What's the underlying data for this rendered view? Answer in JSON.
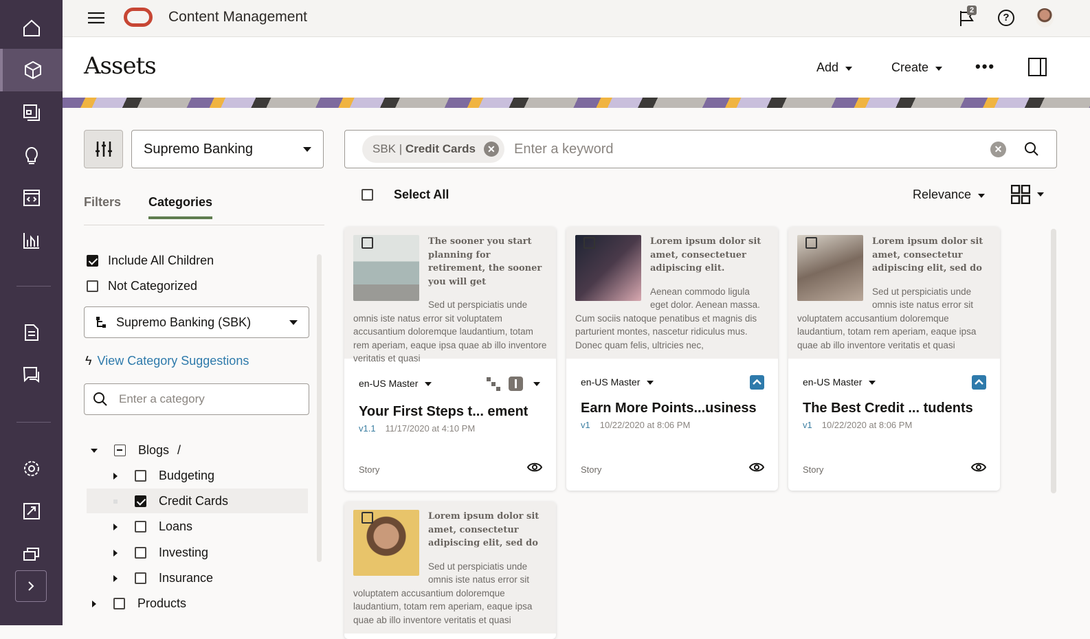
{
  "app": {
    "title": "Content Management",
    "notification_count": "2"
  },
  "sidebar": {
    "items": [
      {
        "name": "home"
      },
      {
        "name": "assets",
        "active": true
      },
      {
        "name": "collections"
      },
      {
        "name": "ideas"
      },
      {
        "name": "sites"
      },
      {
        "name": "analytics"
      },
      {
        "name": "documents"
      },
      {
        "name": "conversations"
      },
      {
        "name": "settings"
      },
      {
        "name": "integrations"
      },
      {
        "name": "repositories"
      },
      {
        "name": "expand"
      }
    ]
  },
  "header": {
    "title": "Assets",
    "add_label": "Add",
    "create_label": "Create"
  },
  "left": {
    "repository": "Supremo Banking",
    "tabs": [
      "Filters",
      "Categories"
    ],
    "include_children": "Include All Children",
    "not_categorized": "Not Categorized",
    "taxonomy": "Supremo Banking (SBK)",
    "suggestions": "View Category Suggestions",
    "category_placeholder": "Enter a category",
    "tree": [
      {
        "label": "Blogs",
        "suffix": "/"
      },
      {
        "label": "Budgeting"
      },
      {
        "label": "Credit Cards",
        "checked": true
      },
      {
        "label": "Loans"
      },
      {
        "label": "Investing"
      },
      {
        "label": "Insurance"
      },
      {
        "label": "Products"
      }
    ]
  },
  "search": {
    "chip": "SBK | Credit Cards",
    "chip_prefix": "SBK | ",
    "chip_main": "Credit Cards",
    "placeholder": "Enter a keyword"
  },
  "toolbar": {
    "select_all": "Select All",
    "sort": "Relevance"
  },
  "cards": [
    {
      "lead": "The sooner you start planning for retirement, the sooner you will get",
      "body": "Sed ut perspiciatis unde omnis iste natus error sit voluptatem accusantium doloremque laudantium, totam rem aperiam, eaque ipsa quae ab illo inventore veritatis et quasi",
      "lang": "en-US Master",
      "title": "Your First Steps t...  ement",
      "version": "v1.1",
      "date": "11/17/2020 at 4:10 PM",
      "type": "Story"
    },
    {
      "lead": "Lorem ipsum dolor sit amet, consectetuer adipiscing elit.",
      "body": "Aenean commodo ligula eget dolor. Aenean massa. Cum sociis natoque penatibus et magnis dis parturient montes, nascetur ridiculus mus. Donec quam felis, ultricies nec,",
      "lang": "en-US Master",
      "title": "Earn More Points...usiness",
      "version": "v1",
      "date": "10/22/2020 at 8:06 PM",
      "type": "Story"
    },
    {
      "lead": "Lorem ipsum dolor sit amet, consectetur adipiscing elit, sed do",
      "body": "Sed ut perspiciatis unde omnis iste natus error sit voluptatem accusantium doloremque laudantium, totam rem aperiam, eaque ipsa quae ab illo inventore veritatis et quasi",
      "lang": "en-US Master",
      "title": "The Best Credit ...  tudents",
      "version": "v1",
      "date": "10/22/2020 at 8:06 PM",
      "type": "Story"
    },
    {
      "lead": "Lorem ipsum dolor sit amet, consectetur adipiscing elit, sed do",
      "body": "Sed ut perspiciatis unde omnis iste natus error sit voluptatem accusantium doloremque laudantium, totam rem aperiam, eaque ipsa quae ab illo inventore veritatis et quasi"
    }
  ],
  "colors": {
    "sidebar": "#3f3347",
    "accent": "#2e7aab",
    "tab_underline": "#5f7d4f",
    "logo": "#c74634"
  }
}
